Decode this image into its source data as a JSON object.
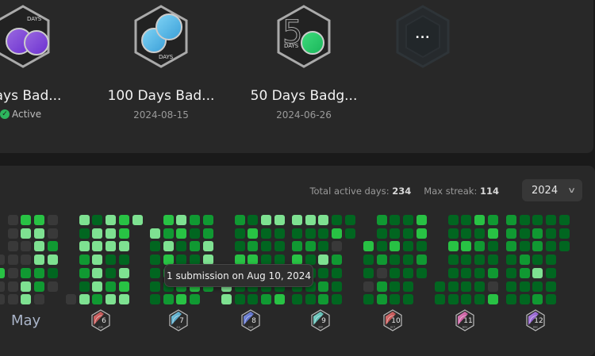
{
  "badges": [
    {
      "name": "Days Bad...",
      "status": "Active",
      "colors": [
        "#9b6ae0",
        "#6a2fd0"
      ],
      "icon": "200-days-badge"
    },
    {
      "name": "100 Days Bad...",
      "date": "2024-08-15",
      "colors": [
        "#7fd3f5",
        "#3a9fd8"
      ],
      "icon": "100-days-badge"
    },
    {
      "name": "50 Days Badg...",
      "date": "2024-06-26",
      "colors": [
        "#3fdc7c",
        "#19b55a"
      ],
      "icon": "50-days-badge"
    },
    {
      "name": "",
      "icon": "more-badges-locked",
      "label": "..."
    }
  ],
  "stats": {
    "active_label": "Total active days: ",
    "active_value": "234",
    "streak_label": "Max streak: ",
    "streak_value": "114"
  },
  "year_select": {
    "value": "2024",
    "icon": "chevron-down-icon"
  },
  "tooltip": "1 submission on Aug 10, 2024",
  "level_colors": [
    "#393939",
    "#016620",
    "#109932",
    "#28c244",
    "#7ee191"
  ],
  "months": [
    {
      "label": "May",
      "grid": [
        [
          null,
          0,
          3,
          3,
          0
        ],
        [
          null,
          0,
          4,
          4,
          0
        ],
        [
          null,
          0,
          0,
          4,
          2
        ],
        [
          0,
          0,
          0,
          4,
          4
        ],
        [
          3,
          0,
          2,
          2,
          1
        ],
        [
          0,
          0,
          4,
          2,
          0
        ],
        [
          0,
          0,
          4,
          0,
          null
        ]
      ]
    },
    {
      "label": "6",
      "sub": "JUN",
      "colors": [
        "#f07b7b",
        "#b33a3a"
      ],
      "grid": [
        [
          null,
          4,
          1,
          4,
          3,
          4
        ],
        [
          null,
          1,
          4,
          4,
          3,
          null
        ],
        [
          null,
          4,
          4,
          4,
          4,
          null
        ],
        [
          null,
          2,
          4,
          1,
          1,
          null
        ],
        [
          null,
          2,
          4,
          1,
          4,
          null
        ],
        [
          null,
          1,
          4,
          2,
          3,
          null
        ],
        [
          0,
          4,
          2,
          4,
          4,
          null
        ]
      ]
    },
    {
      "label": "7",
      "sub": "JUL",
      "colors": [
        "#8fe0f7",
        "#2f8fc2"
      ],
      "grid": [
        [
          null,
          3,
          4,
          2,
          2
        ],
        [
          4,
          2,
          3,
          1,
          2
        ],
        [
          1,
          4,
          1,
          2,
          4
        ],
        [
          1,
          3,
          1,
          1,
          4
        ],
        [
          1,
          2,
          1,
          1,
          4
        ],
        [
          1,
          1,
          2,
          3,
          2
        ],
        [
          1,
          2,
          3,
          2,
          null
        ]
      ]
    },
    {
      "label": "8",
      "sub": "AUG",
      "colors": [
        "#8fa4f5",
        "#3a4fc2"
      ],
      "grid": [
        [
          null,
          2,
          1,
          4,
          4
        ],
        [
          null,
          1,
          3,
          1,
          1
        ],
        [
          null,
          1,
          2,
          1,
          1
        ],
        [
          null,
          3,
          3,
          1,
          1
        ],
        [
          null,
          1,
          1,
          1,
          1
        ],
        [
          4,
          1,
          1,
          1,
          1
        ],
        [
          4,
          1,
          1,
          2,
          3
        ]
      ]
    },
    {
      "label": "9",
      "sub": "SEP",
      "colors": [
        "#9af0e6",
        "#2fa9a0"
      ],
      "grid": [
        [
          4,
          4,
          4,
          1,
          1
        ],
        [
          1,
          1,
          1,
          3,
          1
        ],
        [
          2,
          2,
          1,
          0,
          null
        ],
        [
          3,
          1,
          4,
          2,
          null
        ],
        [
          1,
          1,
          1,
          1,
          null
        ],
        [
          1,
          1,
          2,
          1,
          null
        ],
        [
          1,
          1,
          2,
          1,
          null
        ]
      ]
    },
    {
      "label": "10",
      "sub": "OCT",
      "colors": [
        "#f58a8a",
        "#b52b2b"
      ],
      "grid": [
        [
          null,
          2,
          1,
          1,
          3
        ],
        [
          null,
          1,
          1,
          1,
          3
        ],
        [
          3,
          1,
          3,
          1,
          1
        ],
        [
          1,
          2,
          1,
          1,
          2
        ],
        [
          1,
          0,
          1,
          1,
          1
        ],
        [
          0,
          2,
          1,
          1,
          null
        ],
        [
          1,
          2,
          1,
          1,
          null
        ]
      ]
    },
    {
      "label": "11",
      "sub": "NOV",
      "colors": [
        "#f59ad3",
        "#c22f8a"
      ],
      "grid": [
        [
          null,
          1,
          1,
          3,
          2
        ],
        [
          null,
          1,
          1,
          1,
          3
        ],
        [
          null,
          3,
          3,
          2,
          1
        ],
        [
          null,
          1,
          1,
          1,
          1
        ],
        [
          null,
          1,
          1,
          1,
          2
        ],
        [
          1,
          1,
          1,
          1,
          0
        ],
        [
          1,
          1,
          1,
          1,
          3
        ]
      ]
    },
    {
      "label": "12",
      "sub": "DEC",
      "colors": [
        "#c79af5",
        "#7a3ad0"
      ],
      "grid": [
        [
          2,
          1,
          1,
          1,
          1
        ],
        [
          2,
          1,
          2,
          1,
          1
        ],
        [
          2,
          1,
          2,
          1,
          1
        ],
        [
          1,
          2,
          1,
          1,
          null
        ],
        [
          1,
          2,
          4,
          1,
          null
        ],
        [
          1,
          1,
          1,
          1,
          null
        ],
        [
          1,
          1,
          2,
          1,
          null
        ]
      ]
    }
  ]
}
